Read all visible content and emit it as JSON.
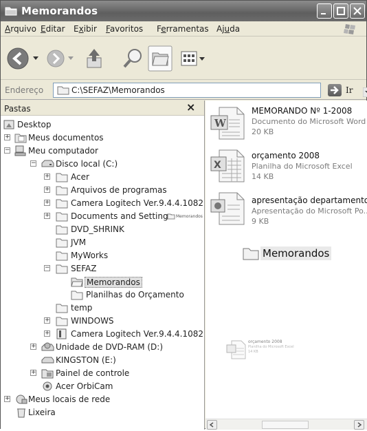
{
  "window": {
    "title": "Memorandos"
  },
  "menu": {
    "items": [
      {
        "key": "A",
        "rest": "rquivo"
      },
      {
        "key": "E",
        "rest": "ditar",
        "pre": ""
      },
      {
        "pre": "E",
        "key": "x",
        "rest": "ibir"
      },
      {
        "key": "F",
        "rest": "avoritos"
      },
      {
        "pre": "F",
        "key": "e",
        "rest": "rramentas"
      },
      {
        "pre": "Aj",
        "key": "u",
        "rest": "da"
      }
    ]
  },
  "address": {
    "label": "Endereço",
    "value": "C:\\SEFAZ\\Memorandos",
    "go_label": "Ir"
  },
  "folders": {
    "title": "Pastas",
    "close": "×",
    "tree": {
      "desktop": "Desktop",
      "meus_documentos": "Meus documentos",
      "meu_computador": "Meu computador",
      "disco_local": "Disco local (C:)",
      "acer": "Acer",
      "arquivos_programas": "Arquivos de programas",
      "camera_logitech": "Camera Logitech Ver.9.4.4.1082",
      "documents_settings": "Documents and Settings",
      "dvd_shrink": "DVD_SHRINK",
      "jvm": "JVM",
      "myworks": "MyWorks",
      "sefaz": "SEFAZ",
      "memorandos": "Memorandos",
      "planilhas": "Planilhas do Orçamento",
      "temp": "temp",
      "windows": "WINDOWS",
      "camera_logitech_2": "Camera Logitech Ver.9.4.4.1082",
      "dvd_ram": "Unidade de DVD-RAM (D:)",
      "kingston": "KINGSTON (E:)",
      "painel": "Painel de controle",
      "orbicam": "Acer OrbiCam",
      "meus_locais": "Meus locais de rede",
      "lixeira": "Lixeira"
    },
    "drag_ghost": "Memorandos"
  },
  "files": [
    {
      "name": "MEMORANDO Nº 1-2008",
      "type": "Documento do Microsoft Word",
      "size": "20 KB",
      "icon": "word-doc-icon"
    },
    {
      "name": "orçamento 2008",
      "type": "Planilha do Microsoft Excel",
      "size": "14 KB",
      "icon": "excel-sheet-icon"
    },
    {
      "name": "apresentação departamento",
      "type": "Apresentação do Microsoft Po...",
      "size": "9 KB",
      "icon": "powerpoint-icon"
    }
  ],
  "drag_folder": {
    "label": "Memorandos"
  },
  "drag_file_ghost": {
    "name": "orçamento 2008",
    "type": "Planilha do Microsoft Excel",
    "size": "14 KB"
  }
}
